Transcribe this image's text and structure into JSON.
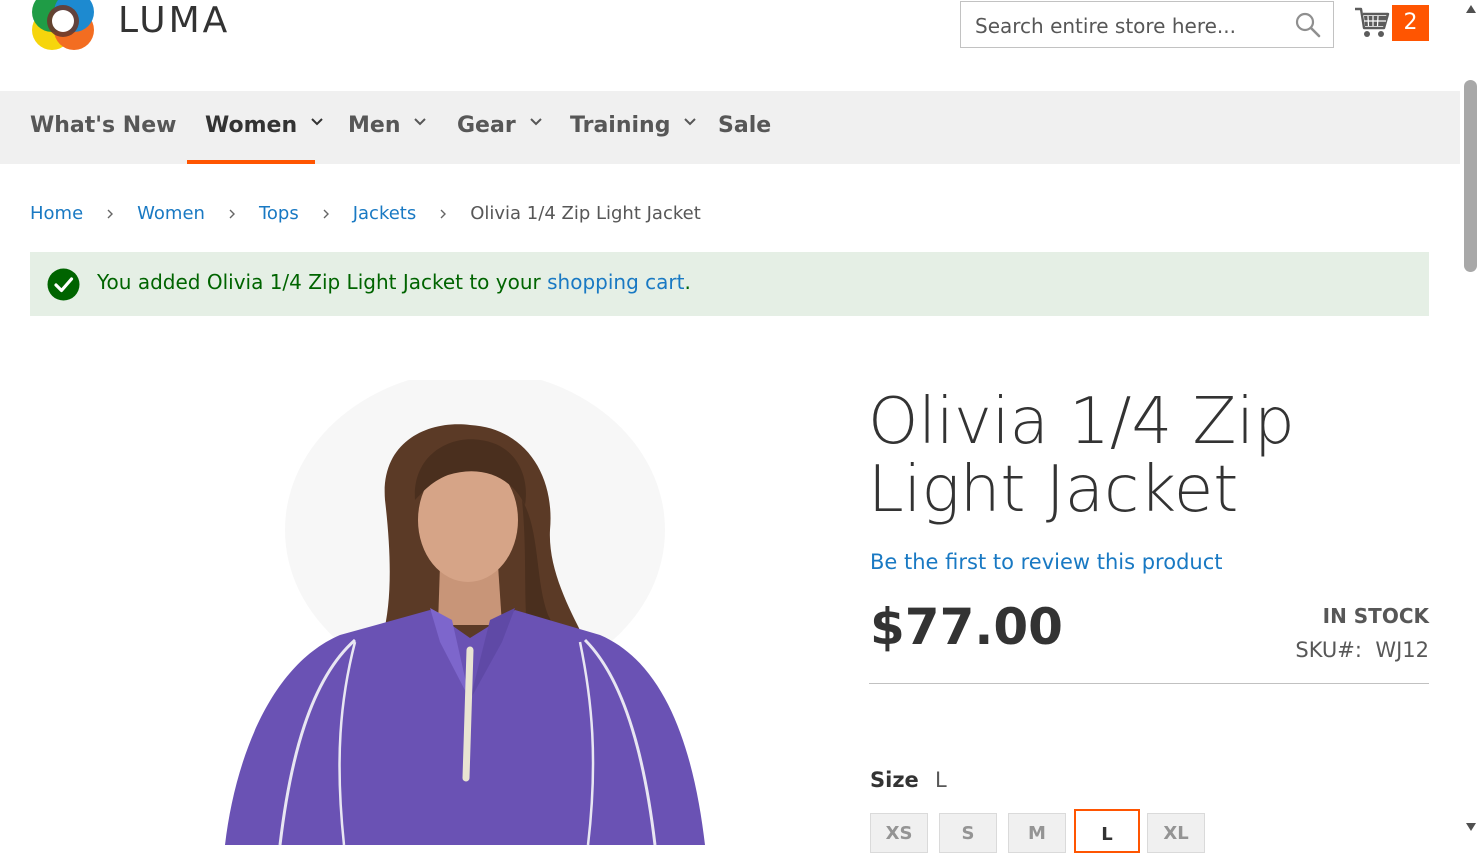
{
  "header": {
    "logo_text": "LUMA",
    "search_placeholder": "Search entire store here...",
    "cart_count": "2"
  },
  "nav": {
    "items": [
      {
        "label": "What's New",
        "has_dropdown": false,
        "active": false
      },
      {
        "label": "Women",
        "has_dropdown": true,
        "active": true
      },
      {
        "label": "Men",
        "has_dropdown": true,
        "active": false
      },
      {
        "label": "Gear",
        "has_dropdown": true,
        "active": false
      },
      {
        "label": "Training",
        "has_dropdown": true,
        "active": false
      },
      {
        "label": "Sale",
        "has_dropdown": false,
        "active": false
      }
    ]
  },
  "breadcrumb": {
    "items": [
      "Home",
      "Women",
      "Tops",
      "Jackets"
    ],
    "current": "Olivia 1/4 Zip Light Jacket"
  },
  "message": {
    "prefix": "You added Olivia 1/4 Zip Light Jacket to your ",
    "link": "shopping cart",
    "suffix": "."
  },
  "product": {
    "title": "Olivia 1/4 Zip Light Jacket",
    "review_link": "Be the first to review this product",
    "price": "$77.00",
    "stock": "IN STOCK",
    "sku_label": "SKU#:",
    "sku": "WJ12",
    "size_label": "Size",
    "size_selected": "L",
    "sizes": [
      "XS",
      "S",
      "M",
      "L",
      "XL"
    ]
  },
  "colors": {
    "accent": "#ff5501",
    "link": "#1979c3",
    "success_bg": "#e5efe5",
    "success_text": "#006400",
    "jacket": "#6a52b4"
  }
}
